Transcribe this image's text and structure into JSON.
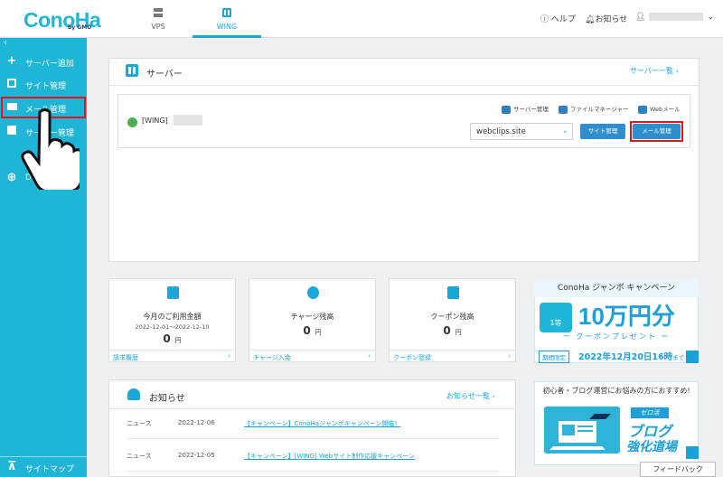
{
  "header": {
    "logo": "ConoHa",
    "logo_sub": "by GMO",
    "tabs": [
      {
        "label": "VPS",
        "icon": "server-icon"
      },
      {
        "label": "WING",
        "icon": "wing-icon"
      }
    ],
    "help": "ヘルプ",
    "notices": "お知らせ"
  },
  "sidebar": {
    "collapse": "‹",
    "items": [
      {
        "label": "サーバー追加",
        "icon": "plus-icon"
      },
      {
        "label": "サイト管理",
        "icon": "window-icon"
      },
      {
        "label": "メール管理",
        "icon": "mail-icon"
      },
      {
        "label": "サーバー管理",
        "icon": "server-icon"
      },
      {
        "label": "DNS",
        "icon": "globe-icon"
      }
    ],
    "bottom": "サイトマップ"
  },
  "server": {
    "title": "サーバー",
    "list_link": "サーバー一覧",
    "name": "[WING]",
    "tools": [
      "サーバー管理",
      "ファイルマネージャー",
      "Webメール"
    ],
    "domain": "webclips.site",
    "site_btn": "サイト管理",
    "mail_btn": "メール管理"
  },
  "cards": [
    {
      "title": "今月のご利用金額",
      "sub": "2022-12-01〜2022-12-10",
      "value": "0",
      "unit": "円",
      "footer": "請求履歴"
    },
    {
      "title": "チャージ残高",
      "sub": "",
      "value": "0",
      "unit": "円",
      "footer": "チャージ入金"
    },
    {
      "title": "クーポン残高",
      "sub": "",
      "value": "0",
      "unit": "円",
      "footer": "クーポン登録"
    }
  ],
  "banner1": {
    "title": "ConoHa ジャンボ キャンペーン",
    "rank": "1等",
    "main": "10万円分",
    "coupon": "ー クーポンプレゼント ー",
    "limit": "期間限定",
    "date": "2022年12月20日16時",
    "date_suffix": "まで"
  },
  "news": {
    "title": "お知らせ",
    "more": "お知らせ一覧",
    "rows": [
      {
        "cat": "ニュース",
        "date": "2022-12-06",
        "text": "【キャンペーン】ConoHaジャンボキャンペーン開催！"
      },
      {
        "cat": "ニュース",
        "date": "2022-12-05",
        "text": "【キャンペーン】[WING] Webサイト制作応援キャンペーン"
      }
    ]
  },
  "banner2": {
    "head": "初心者・ブログ運営にお悩みの方におすすめ!",
    "tag": "ゼロ活",
    "line1": "ブログ",
    "line2": "強化道場"
  },
  "feedback": "フィードバック",
  "colors": {
    "accent": "#1fb5d6",
    "highlight": "#e8131a",
    "link": "#1aa7d8"
  }
}
